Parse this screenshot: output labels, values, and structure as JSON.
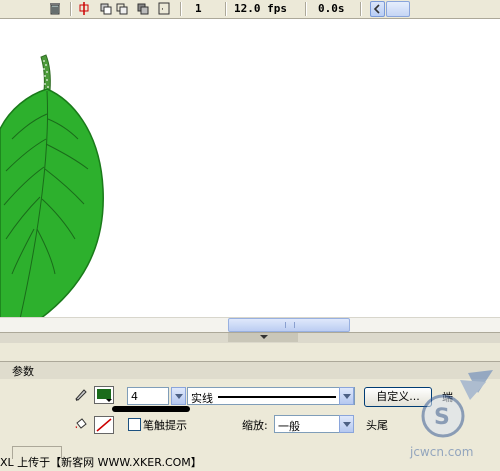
{
  "timeline": {
    "frame": "1",
    "fps": "12.0 fps",
    "time": "0.0s"
  },
  "properties": {
    "tab_label": "参数",
    "stroke_color": "#1a6b1a",
    "stroke_width": "4",
    "stroke_style": "实线",
    "custom_button": "自定义...",
    "stroke_hinting_label": "笔触提示",
    "scale_label": "缩放:",
    "scale_value": "一般",
    "cap_label": "头尾",
    "extra_right_label": "端"
  },
  "footer": {
    "text": "XL 上传于【新客网 WWW.XKER.COM】"
  },
  "watermark": {
    "text": "jcwcn.com"
  },
  "colors": {
    "leaf_fill": "#2db02d",
    "leaf_dark": "#1a7a1a",
    "stem": "#4c9a3a"
  },
  "icons": {
    "trash": "trash-icon",
    "onion": "onion-skin-icon",
    "pencil": "pencil-icon",
    "bucket": "paint-bucket-icon"
  }
}
